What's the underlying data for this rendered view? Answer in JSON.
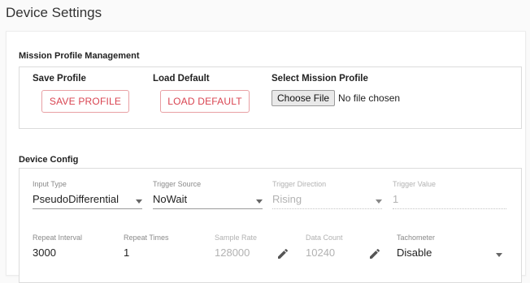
{
  "page": {
    "title": "Device Settings"
  },
  "mission_profile": {
    "section_title": "Mission Profile Management",
    "save": {
      "heading": "Save Profile",
      "button_label": "SAVE PROFILE"
    },
    "load": {
      "heading": "Load Default",
      "button_label": "LOAD DEFAULT"
    },
    "select": {
      "heading": "Select Mission Profile",
      "button_label": "Choose File",
      "status": "No file chosen"
    }
  },
  "device_config": {
    "section_title": "Device Config",
    "input_type": {
      "label": "Input Type",
      "value": "PseudoDifferential"
    },
    "trigger_source": {
      "label": "Trigger Source",
      "value": "NoWait"
    },
    "trigger_direction": {
      "label": "Trigger Direction",
      "value": "Rising"
    },
    "trigger_value": {
      "label": "Trigger Value",
      "value": "1"
    },
    "repeat_interval": {
      "label": "Repeat Interval",
      "value": "3000"
    },
    "repeat_times": {
      "label": "Repeat Times",
      "value": "1"
    },
    "sample_rate": {
      "label": "Sample Rate",
      "value": "128000"
    },
    "data_count": {
      "label": "Data Count",
      "value": "10240"
    },
    "tachometer": {
      "label": "Tachometer",
      "value": "Disable"
    }
  },
  "colors": {
    "accent": "#d94451",
    "accent_border": "#e8a0a4",
    "label_gray": "#8a8a8a",
    "disabled_gray": "#b2b2b2",
    "icon_dark": "#555555"
  },
  "icons": {
    "edit": "pencil-icon",
    "dropdown": "caret-down-icon"
  }
}
